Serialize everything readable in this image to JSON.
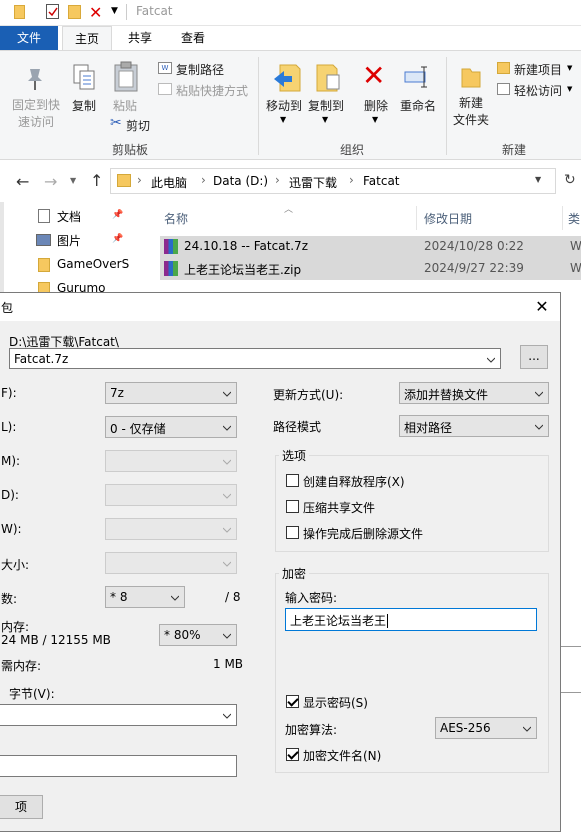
{
  "window": {
    "title": "Fatcat"
  },
  "ribbon_tabs": [
    "文件",
    "主页",
    "共享",
    "查看"
  ],
  "ribbon": {
    "pin": "固定到快\n速访问",
    "copy": "复制",
    "paste": "粘贴",
    "copy_path": "复制路径",
    "paste_shortcut": "粘贴快捷方式",
    "cut": "剪切",
    "clipboard": "剪贴板",
    "move_to": "移动到",
    "copy_to": "复制到",
    "delete": "删除",
    "rename": "重命名",
    "organize": "组织",
    "new_folder": "新建\n文件夹",
    "new_item": "新建项目",
    "easy_access": "轻松访问",
    "new": "新建"
  },
  "address": {
    "crumbs": [
      "此电脑",
      "Data (D:)",
      "迅雷下载",
      "Fatcat"
    ]
  },
  "nav": [
    "文档",
    "图片",
    "GameOverS",
    "Gurumo"
  ],
  "files": {
    "col_name": "名称",
    "col_date": "修改日期",
    "col_type": "类",
    "rows": [
      {
        "name": "24.10.18 -- Fatcat.7z",
        "date": "2024/10/28 0:22",
        "type": "W"
      },
      {
        "name": "上老王论坛当老王.zip",
        "date": "2024/9/27 22:39",
        "type": "W"
      }
    ]
  },
  "dialog": {
    "title": "包",
    "path": "D:\\迅雷下载\\Fatcat\\",
    "archive": "Fatcat.7z",
    "browse": "...",
    "lbl_format": "F):",
    "format": "7z",
    "lbl_level": "L):",
    "level": "0 - 仅存储",
    "lbl_method": "M):",
    "lbl_dict": "D):",
    "lbl_word": "W):",
    "lbl_solid": "大小:",
    "lbl_threads": "数:",
    "threads": "* 8",
    "threads_max": "/ 8",
    "lbl_memory": "内存:",
    "memory": "24 MB / 12155 MB",
    "memory_pct": "* 80%",
    "lbl_decomp": "需内存:",
    "decomp": "1 MB",
    "lbl_split": "字节(V):",
    "params_btn": "项",
    "lbl_update": "更新方式(U):",
    "update": "添加并替换文件",
    "lbl_pathmode": "路径模式",
    "pathmode": "相对路径",
    "options_title": "选项",
    "opt_sfx": "创建自释放程序(X)",
    "opt_shared": "压缩共享文件",
    "opt_delete": "操作完成后删除源文件",
    "enc_title": "加密",
    "lbl_password": "输入密码:",
    "password": "上老王论坛当老王",
    "show_password": "显示密码(S)",
    "lbl_enc_method": "加密算法:",
    "enc_method": "AES-256",
    "enc_names": "加密文件名(N)"
  }
}
